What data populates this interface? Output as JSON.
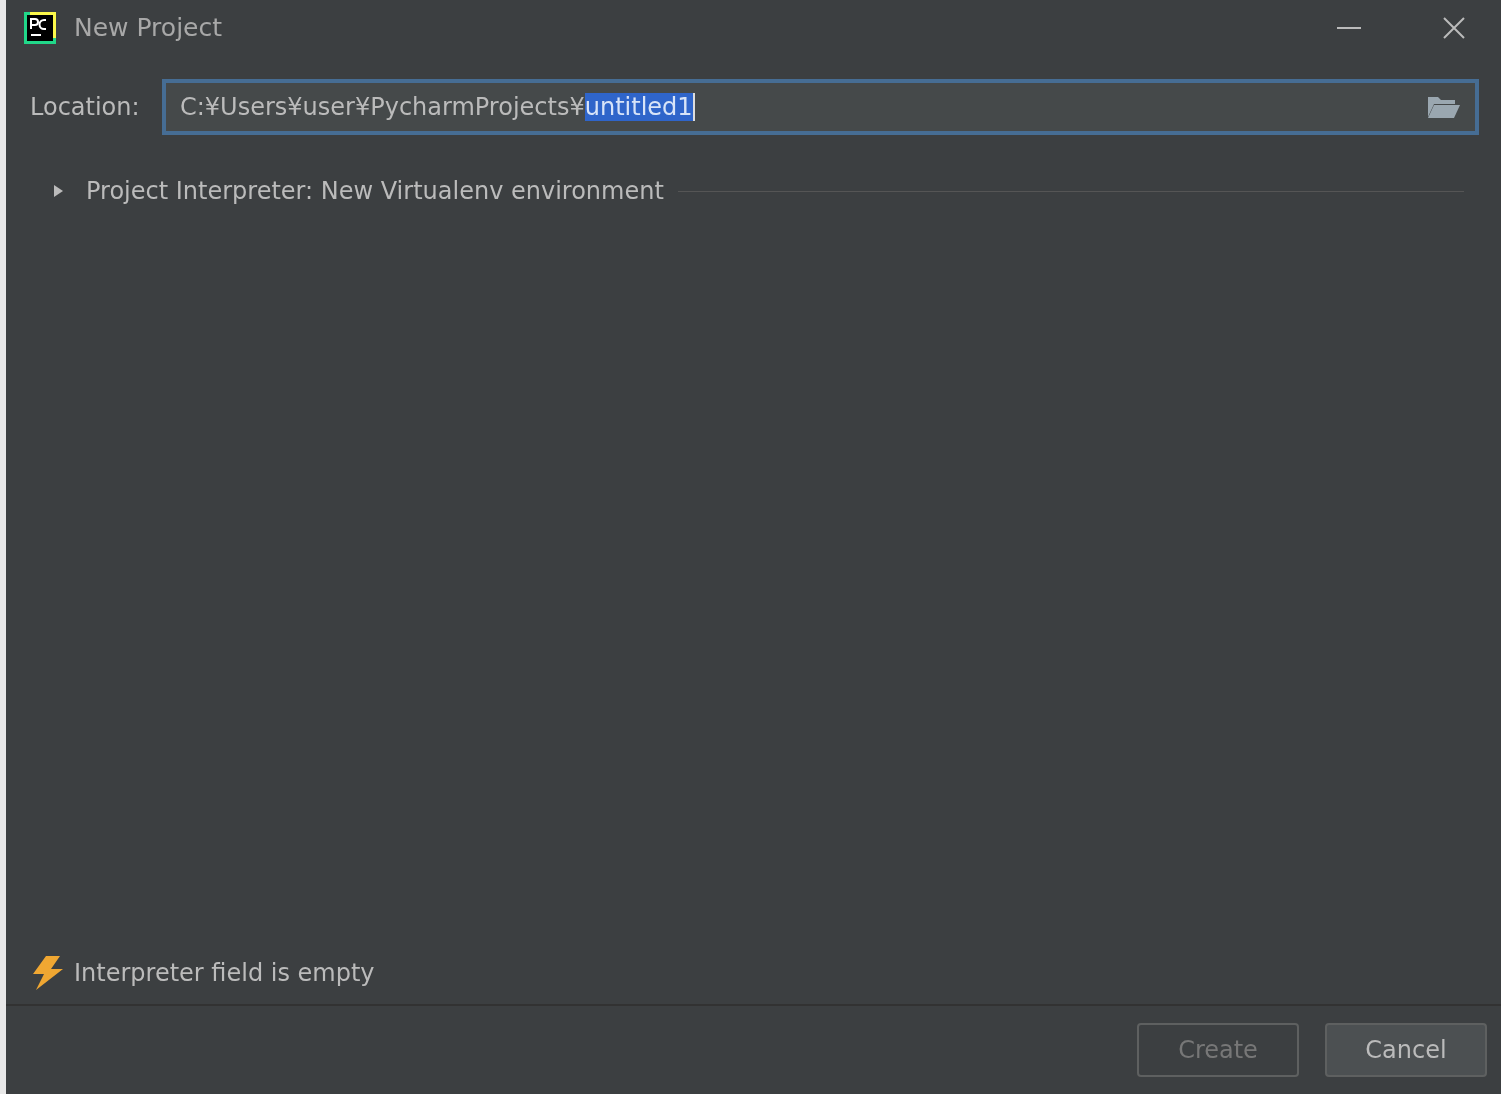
{
  "window": {
    "title": "New Project"
  },
  "location": {
    "label": "Location:",
    "value_parts": [
      {
        "text": "C:¥Users¥user¥PycharmProjects¥",
        "selected": false
      },
      {
        "text": "untitled1",
        "selected": true
      }
    ],
    "focused": true
  },
  "interpreter_section": {
    "label": "Project Interpreter: New Virtualenv environment",
    "expanded": false
  },
  "validation": {
    "message": "Interpreter field is empty"
  },
  "buttons": [
    {
      "label": "Create",
      "disabled": true
    },
    {
      "label": "Cancel",
      "disabled": false
    }
  ]
}
